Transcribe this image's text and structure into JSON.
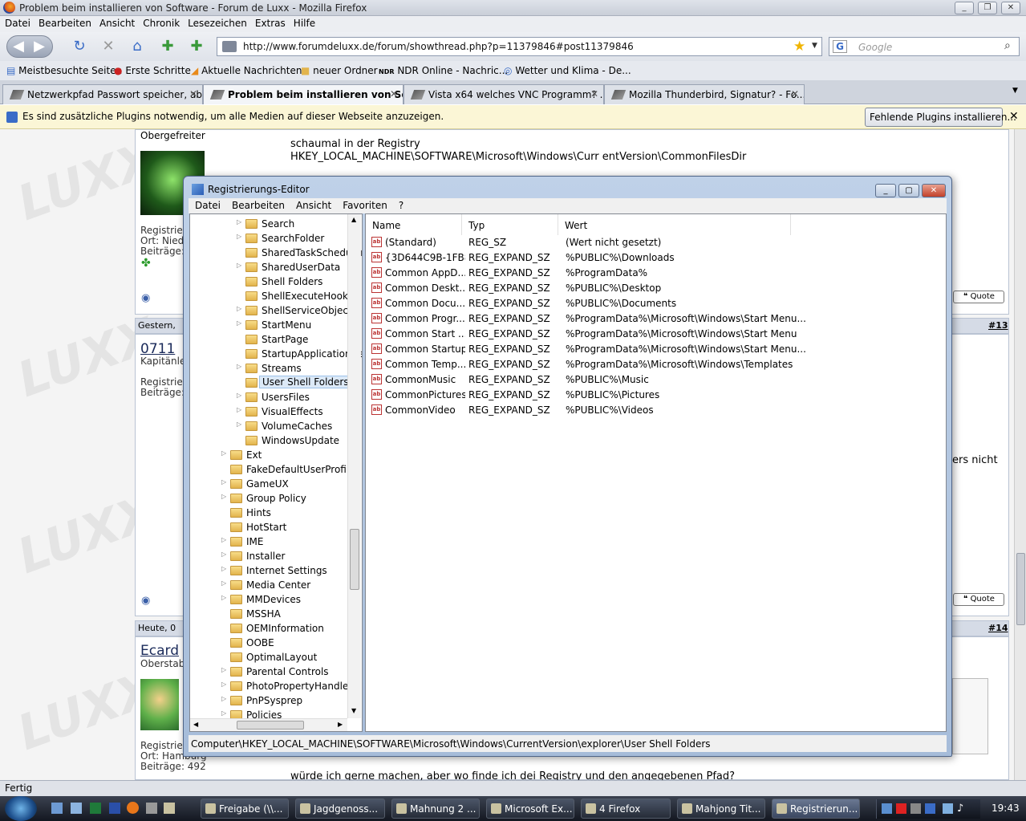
{
  "firefox": {
    "title": "Problem beim installieren von Software - Forum de Luxx - Mozilla Firefox",
    "menu": [
      "Datei",
      "Bearbeiten",
      "Ansicht",
      "Chronik",
      "Lesezeichen",
      "Extras",
      "Hilfe"
    ],
    "url": "http://www.forumdeluxx.de/forum/showthread.php?p=11379846#post11379846",
    "search_placeholder": "Google",
    "bookmarks": [
      "Meistbesuchte Seiten",
      "Erste Schritte",
      "Aktuelle Nachrichten",
      "neuer Ordner",
      "NDR Online - Nachric...",
      "Wetter und Klima - De..."
    ],
    "tabs": [
      {
        "label": "Netzwerkpfad Passwort speicher, ab...",
        "active": false
      },
      {
        "label": "Problem beim installieren von So...",
        "active": true
      },
      {
        "label": "Vista x64 welches VNC Programm? ...",
        "active": false
      },
      {
        "label": "Mozilla Thunderbird, Signatur? - Fo...",
        "active": false
      }
    ],
    "plugin_notice": "Es sind zusätzliche Plugins notwendig, um alle Medien auf dieser Webseite anzuzeigen.",
    "plugin_button": "Fehlende Plugins installieren...",
    "status": "Fertig"
  },
  "forum": {
    "rank1": "Obergefreiter",
    "post_text_1": "schaumal in der Registry",
    "post_text_2": "HKEY_LOCAL_MACHINE\\SOFTWARE\\Microsoft\\Windows\\Curr entVersion\\CommonFilesDir",
    "reg1": "Registrier",
    "ort1": "Ort: Nied",
    "beitrage1": "Beiträge:",
    "date2": "Gestern,",
    "user2": "0711",
    "rank2": "Kapitänle",
    "reg2": "Registrier",
    "beitrage2": "Beiträge:",
    "postnum2": "#13",
    "partial_text": "ers nicht",
    "date3": "Heute, 0",
    "user3": "Ecard",
    "rank3": "Oberstab",
    "reg3": "Registrier",
    "ort3": "Ort: Hamburg",
    "beitrage3": "Beiträge: 492",
    "postnum3": "#14",
    "bottom_text": "würde ich gerne machen, aber wo finde ich dei Registry und den angegebenen Pfad?",
    "quote_label": "Quote"
  },
  "regedit": {
    "title": "Registrierungs-Editor",
    "menu": [
      "Datei",
      "Bearbeiten",
      "Ansicht",
      "Favoriten",
      "?"
    ],
    "tree": [
      {
        "label": "Search",
        "level": 2,
        "arrow": true
      },
      {
        "label": "SearchFolder",
        "level": 2,
        "arrow": true
      },
      {
        "label": "SharedTaskScheduler",
        "level": 2,
        "arrow": false
      },
      {
        "label": "SharedUserData",
        "level": 2,
        "arrow": true
      },
      {
        "label": "Shell Folders",
        "level": 2,
        "arrow": false
      },
      {
        "label": "ShellExecuteHooks",
        "level": 2,
        "arrow": false
      },
      {
        "label": "ShellServiceObjects",
        "level": 2,
        "arrow": true
      },
      {
        "label": "StartMenu",
        "level": 2,
        "arrow": true
      },
      {
        "label": "StartPage",
        "level": 2,
        "arrow": false
      },
      {
        "label": "StartupApplicationManager",
        "level": 2,
        "arrow": false
      },
      {
        "label": "Streams",
        "level": 2,
        "arrow": true
      },
      {
        "label": "User Shell Folders",
        "level": 2,
        "arrow": false,
        "selected": true
      },
      {
        "label": "UsersFiles",
        "level": 2,
        "arrow": true
      },
      {
        "label": "VisualEffects",
        "level": 2,
        "arrow": true
      },
      {
        "label": "VolumeCaches",
        "level": 2,
        "arrow": true
      },
      {
        "label": "WindowsUpdate",
        "level": 2,
        "arrow": false
      },
      {
        "label": "Ext",
        "level": 1,
        "arrow": true
      },
      {
        "label": "FakeDefaultUserProfile",
        "level": 1,
        "arrow": false
      },
      {
        "label": "GameUX",
        "level": 1,
        "arrow": true
      },
      {
        "label": "Group Policy",
        "level": 1,
        "arrow": true
      },
      {
        "label": "Hints",
        "level": 1,
        "arrow": false
      },
      {
        "label": "HotStart",
        "level": 1,
        "arrow": false
      },
      {
        "label": "IME",
        "level": 1,
        "arrow": true
      },
      {
        "label": "Installer",
        "level": 1,
        "arrow": true
      },
      {
        "label": "Internet Settings",
        "level": 1,
        "arrow": true
      },
      {
        "label": "Media Center",
        "level": 1,
        "arrow": true
      },
      {
        "label": "MMDevices",
        "level": 1,
        "arrow": true
      },
      {
        "label": "MSSHA",
        "level": 1,
        "arrow": false
      },
      {
        "label": "OEMInformation",
        "level": 1,
        "arrow": false
      },
      {
        "label": "OOBE",
        "level": 1,
        "arrow": false
      },
      {
        "label": "OptimalLayout",
        "level": 1,
        "arrow": false
      },
      {
        "label": "Parental Controls",
        "level": 1,
        "arrow": true
      },
      {
        "label": "PhotoPropertyHandler",
        "level": 1,
        "arrow": true
      },
      {
        "label": "PnPSysprep",
        "level": 1,
        "arrow": true
      },
      {
        "label": "Policies",
        "level": 1,
        "arrow": true
      }
    ],
    "columns": [
      "Name",
      "Typ",
      "Wert"
    ],
    "values": [
      {
        "name": "(Standard)",
        "type": "REG_SZ",
        "data": "(Wert nicht gesetzt)"
      },
      {
        "name": "{3D644C9B-1FB8...",
        "type": "REG_EXPAND_SZ",
        "data": "%PUBLIC%\\Downloads"
      },
      {
        "name": "Common AppD...",
        "type": "REG_EXPAND_SZ",
        "data": "%ProgramData%"
      },
      {
        "name": "Common Deskt...",
        "type": "REG_EXPAND_SZ",
        "data": "%PUBLIC%\\Desktop"
      },
      {
        "name": "Common Docu...",
        "type": "REG_EXPAND_SZ",
        "data": "%PUBLIC%\\Documents"
      },
      {
        "name": "Common Progr...",
        "type": "REG_EXPAND_SZ",
        "data": "%ProgramData%\\Microsoft\\Windows\\Start Menu..."
      },
      {
        "name": "Common Start ...",
        "type": "REG_EXPAND_SZ",
        "data": "%ProgramData%\\Microsoft\\Windows\\Start Menu"
      },
      {
        "name": "Common Startup",
        "type": "REG_EXPAND_SZ",
        "data": "%ProgramData%\\Microsoft\\Windows\\Start Menu..."
      },
      {
        "name": "Common Temp...",
        "type": "REG_EXPAND_SZ",
        "data": "%ProgramData%\\Microsoft\\Windows\\Templates"
      },
      {
        "name": "CommonMusic",
        "type": "REG_EXPAND_SZ",
        "data": "%PUBLIC%\\Music"
      },
      {
        "name": "CommonPictures",
        "type": "REG_EXPAND_SZ",
        "data": "%PUBLIC%\\Pictures"
      },
      {
        "name": "CommonVideo",
        "type": "REG_EXPAND_SZ",
        "data": "%PUBLIC%\\Videos"
      }
    ],
    "status_path": "Computer\\HKEY_LOCAL_MACHINE\\SOFTWARE\\Microsoft\\Windows\\CurrentVersion\\explorer\\User Shell Folders"
  },
  "taskbar": {
    "items": [
      {
        "label": "Freigabe (\\\\...",
        "active": false
      },
      {
        "label": "Jagdgenoss...",
        "active": false
      },
      {
        "label": "Mahnung 2 ...",
        "active": false
      },
      {
        "label": "Microsoft Ex...",
        "active": false
      },
      {
        "label": "4 Firefox",
        "active": false
      },
      {
        "label": "Mahjong Tit...",
        "active": false
      },
      {
        "label": "Registrierun...",
        "active": true
      }
    ],
    "clock": "19:43"
  },
  "colors": {
    "selection": "#dce9f7",
    "window_frame": "#a6bcd9",
    "taskbar": "#131720"
  }
}
